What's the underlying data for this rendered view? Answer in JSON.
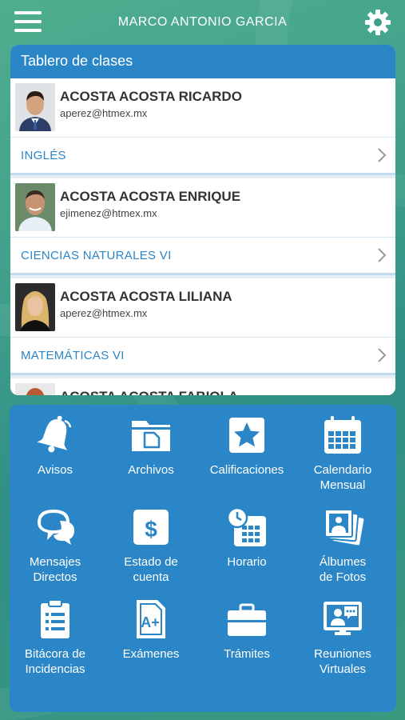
{
  "header": {
    "title": "MARCO ANTONIO GARCIA"
  },
  "board": {
    "title": "Tablero de clases",
    "items": [
      {
        "name": "ACOSTA ACOSTA RICARDO",
        "email": "aperez@htmex.mx",
        "subject": "INGLÉS"
      },
      {
        "name": "ACOSTA ACOSTA ENRIQUE",
        "email": "ejimenez@htmex.mx",
        "subject": "CIENCIAS NATURALES VI"
      },
      {
        "name": "ACOSTA ACOSTA LILIANA",
        "email": "aperez@htmex.mx",
        "subject": "MATEMÁTICAS VI"
      },
      {
        "name": "ACOSTA ACOSTA FABIOLA"
      }
    ]
  },
  "menu": {
    "tiles": [
      {
        "label1": "Avisos",
        "label2": "",
        "icon": "bell-icon"
      },
      {
        "label1": "Archivos",
        "label2": "",
        "icon": "folder-icon"
      },
      {
        "label1": "Calificaciones",
        "label2": "",
        "icon": "star-icon"
      },
      {
        "label1": "Calendario",
        "label2": "Mensual",
        "icon": "calendar-icon"
      },
      {
        "label1": "Mensajes",
        "label2": "Directos",
        "icon": "chat-bubbles-icon"
      },
      {
        "label1": "Estado de",
        "label2": "cuenta",
        "icon": "dollar-icon"
      },
      {
        "label1": "Horario",
        "label2": "",
        "icon": "schedule-icon"
      },
      {
        "label1": "Álbumes",
        "label2": "de Fotos",
        "icon": "photo-album-icon"
      },
      {
        "label1": "Bitácora de",
        "label2": "Incidencias",
        "icon": "clipboard-icon"
      },
      {
        "label1": "Exámenes",
        "label2": "",
        "icon": "exam-grade-icon"
      },
      {
        "label1": "Trámites",
        "label2": "",
        "icon": "briefcase-icon"
      },
      {
        "label1": "Reuniones",
        "label2": "Virtuales",
        "icon": "video-meeting-icon"
      }
    ]
  },
  "colors": {
    "accent": "#2b86c8",
    "background": "#3f9f8a"
  }
}
